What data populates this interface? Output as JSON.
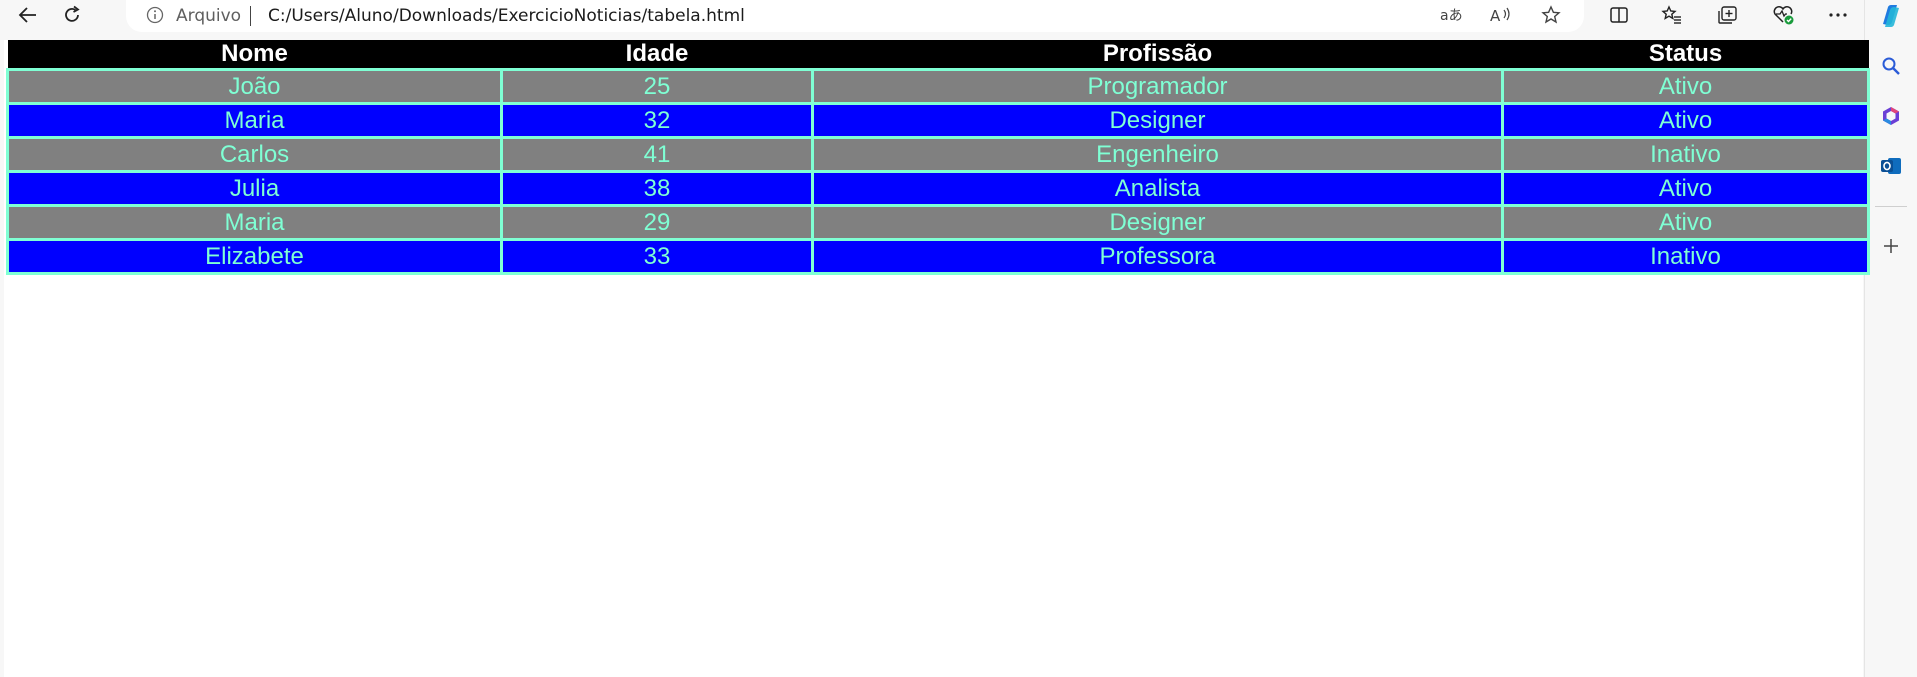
{
  "browser": {
    "address_label": "Arquivo",
    "url": "C:/Users/Aluno/Downloads/ExercicioNoticias/tabela.html"
  },
  "table": {
    "headers": [
      "Nome",
      "Idade",
      "Profissão",
      "Status"
    ],
    "rows": [
      [
        "João",
        "25",
        "Programador",
        "Ativo"
      ],
      [
        "Maria",
        "32",
        "Designer",
        "Ativo"
      ],
      [
        "Carlos",
        "41",
        "Engenheiro",
        "Inativo"
      ],
      [
        "Julia",
        "38",
        "Analista",
        "Ativo"
      ],
      [
        "Maria",
        "29",
        "Designer",
        "Ativo"
      ],
      [
        "Elizabete",
        "33",
        "Professora",
        "Inativo"
      ]
    ]
  },
  "colors": {
    "header_bg": "#000000",
    "row_odd_bg": "#808080",
    "row_even_bg": "#0000ff",
    "cell_text": "#7fffd4",
    "cell_border": "#7fffd4"
  },
  "icons": {
    "toolbar": [
      "back-arrow-icon",
      "refresh-icon",
      "info-icon",
      "read-aloud-icon",
      "translate-icon",
      "favorite-star-icon",
      "split-screen-icon",
      "favorites-icon",
      "collections-icon",
      "browser-essentials-icon",
      "more-options-icon",
      "copilot-icon"
    ],
    "sidebar": [
      "search-icon",
      "office-icon",
      "outlook-icon",
      "add-icon"
    ]
  }
}
